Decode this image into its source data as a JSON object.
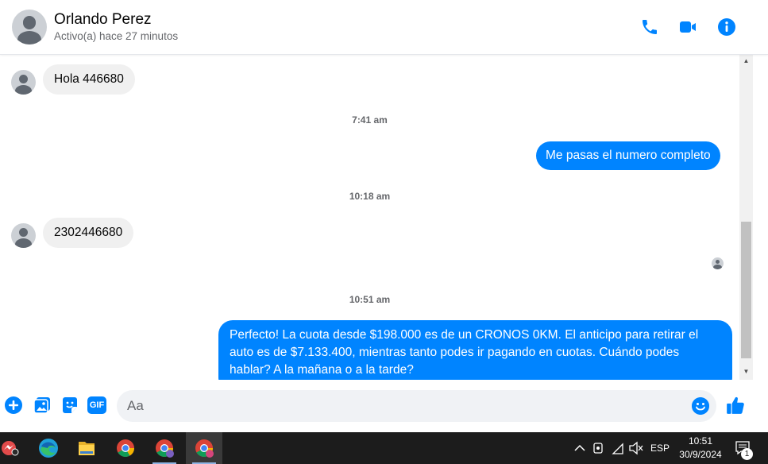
{
  "header": {
    "contact_name": "Orlando Perez",
    "status": "Activo(a) hace 27 minutos",
    "icons": [
      "phone-icon",
      "video-call-icon",
      "info-icon"
    ]
  },
  "messages": [
    {
      "type": "incoming",
      "text": "Hola 446680"
    },
    {
      "type": "timestamp",
      "text": "7:41 am"
    },
    {
      "type": "outgoing",
      "text": "Me pasas el numero completo"
    },
    {
      "type": "timestamp",
      "text": "10:18 am"
    },
    {
      "type": "incoming",
      "text": "2302446680"
    },
    {
      "type": "timestamp",
      "text": "10:51 am"
    },
    {
      "type": "outgoing",
      "lines": [
        "Perfecto! La cuota desde $198.000 es de un CRONOS 0KM. El anticipo para retirar el",
        "auto es de $7.133.400, mientras tanto podes ir pagando en cuotas. Cuándo podes",
        "hablar? A la mañana o a la tarde?"
      ]
    }
  ],
  "composer": {
    "placeholder": "Aa",
    "gif_label": "GIF",
    "icons": [
      "add-icon",
      "photo-icon",
      "sticker-icon",
      "gif-icon",
      "emoji-icon",
      "like-icon"
    ]
  },
  "taskbar": {
    "apps": [
      "messenger-app-icon",
      "edge-icon",
      "file-explorer-icon",
      "chrome-icon",
      "chrome-profile-icon",
      "chrome-active-icon"
    ],
    "tray": {
      "language": "ESP",
      "time": "10:51",
      "date": "30/9/2024",
      "notification_count": "1"
    }
  },
  "colors": {
    "accent": "#0084ff",
    "bubble_in": "#f0f0f0",
    "taskbar": "#1c1c1c"
  }
}
